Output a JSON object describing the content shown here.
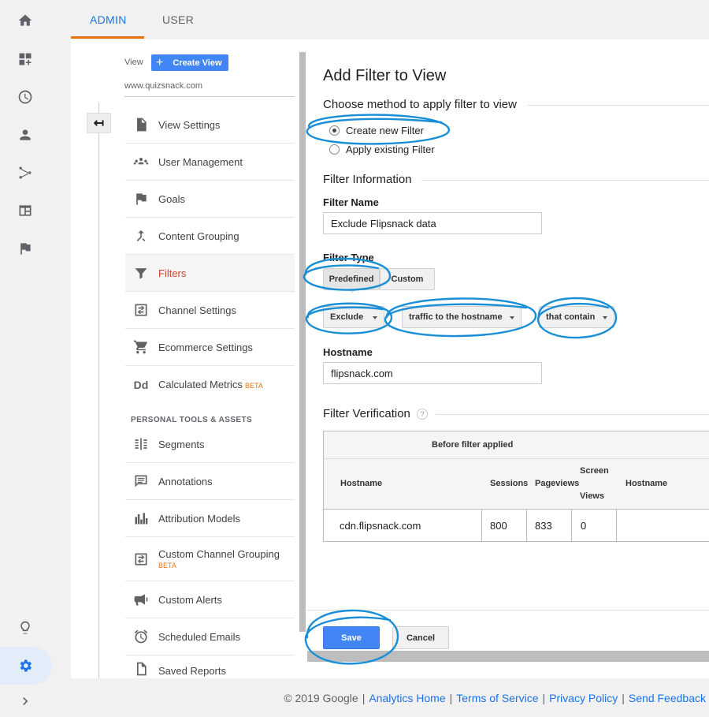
{
  "top_tabs": {
    "admin": "ADMIN",
    "user": "USER"
  },
  "view": {
    "label": "View",
    "create_button": "Create View",
    "current_view": "www.quizsnack.com"
  },
  "menu": {
    "items": [
      {
        "label": "View Settings",
        "icon": "document-icon"
      },
      {
        "label": "User Management",
        "icon": "people-icon"
      },
      {
        "label": "Goals",
        "icon": "flag-icon"
      },
      {
        "label": "Content Grouping",
        "icon": "grouping-icon"
      },
      {
        "label": "Filters",
        "icon": "funnel-icon",
        "active": true
      },
      {
        "label": "Channel Settings",
        "icon": "channel-icon"
      },
      {
        "label": "Ecommerce Settings",
        "icon": "cart-icon"
      },
      {
        "label": "Calculated Metrics",
        "icon": "dd-icon",
        "badge": "BETA"
      }
    ],
    "section_heading": "PERSONAL TOOLS & ASSETS",
    "tools": [
      {
        "label": "Segments",
        "icon": "segments-icon"
      },
      {
        "label": "Annotations",
        "icon": "annotation-icon"
      },
      {
        "label": "Attribution Models",
        "icon": "bars-icon"
      },
      {
        "label": "Custom Channel Grouping",
        "icon": "channel-icon",
        "badge": "BETA"
      },
      {
        "label": "Custom Alerts",
        "icon": "megaphone-icon"
      },
      {
        "label": "Scheduled Emails",
        "icon": "alarm-icon"
      },
      {
        "label": "Saved Reports",
        "icon": "document-icon"
      }
    ]
  },
  "form": {
    "title": "Add Filter to View",
    "method_section": "Choose method to apply filter to view",
    "method_options": [
      "Create new Filter",
      "Apply existing Filter"
    ],
    "info_section": "Filter Information",
    "filter_name_label": "Filter Name",
    "filter_name_value": "Exclude Flipsnack data",
    "filter_type_label": "Filter Type",
    "type_buttons": {
      "predefined": "Predefined",
      "custom": "Custom"
    },
    "dropdowns": {
      "action": "Exclude",
      "source": "traffic to the hostname",
      "condition": "that contain"
    },
    "hostname_label": "Hostname",
    "hostname_value": "flipsnack.com",
    "verification_section": "Filter Verification",
    "help": "?"
  },
  "verification_table": {
    "group_header": "Before filter applied",
    "columns": [
      "Hostname",
      "Sessions",
      "Pageviews",
      "Screen Views",
      "Hostname"
    ],
    "screen_views_lines": [
      "Screen",
      "Views"
    ],
    "rows": [
      {
        "hostname": "cdn.flipsnack.com",
        "sessions": "800",
        "pageviews": "833",
        "screen_views": "0"
      }
    ]
  },
  "actions": {
    "save": "Save",
    "cancel": "Cancel"
  },
  "footer": {
    "copyright": "© 2019 Google",
    "links": [
      "Analytics Home",
      "Terms of Service",
      "Privacy Policy",
      "Send Feedback"
    ],
    "separator": "|"
  },
  "colors": {
    "accent_blue": "#4285f4",
    "tab_underline": "#e8710a",
    "active_menu": "#d23f31",
    "annotation": "#1a8fd6"
  }
}
